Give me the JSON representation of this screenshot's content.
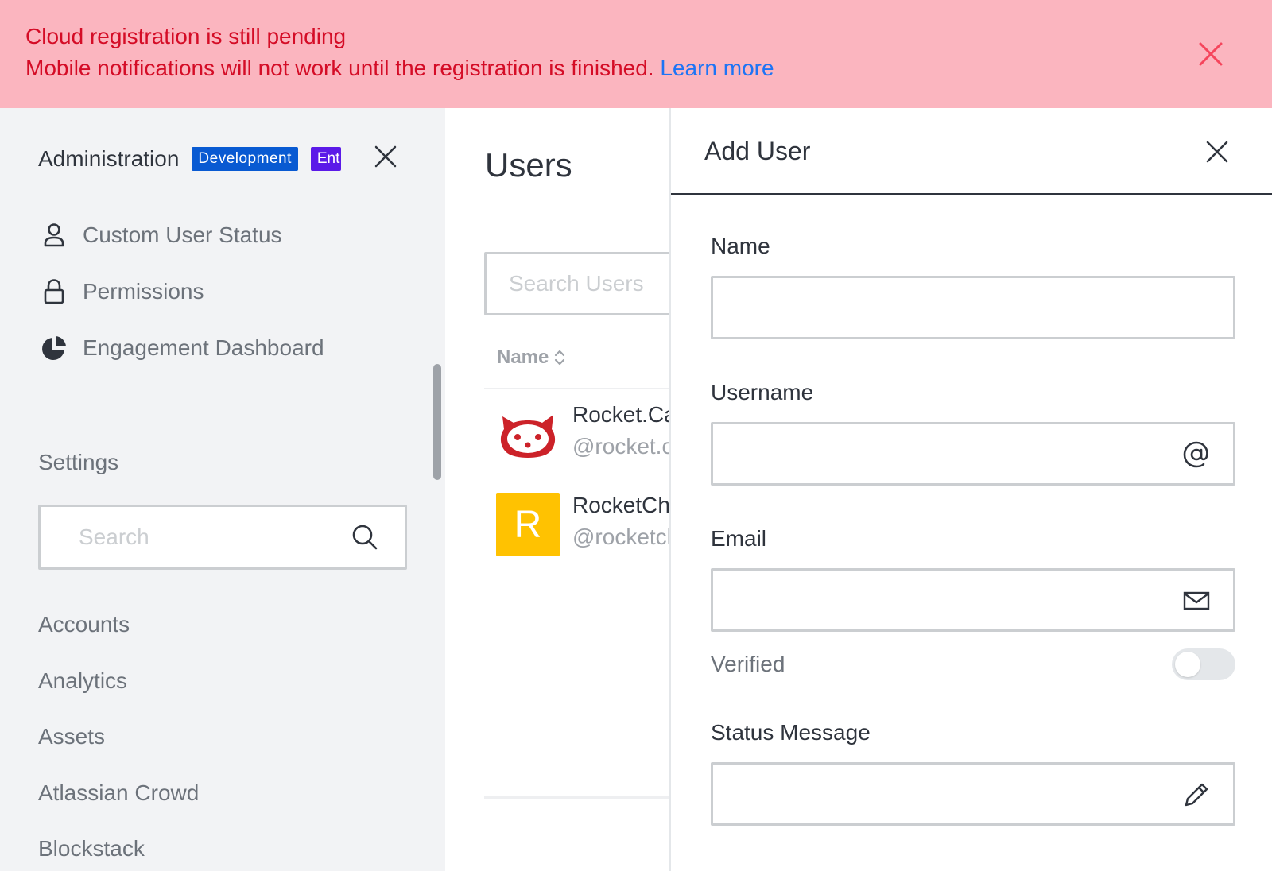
{
  "banner": {
    "title": "Cloud registration is still pending",
    "message": "Mobile notifications will not work until the registration is finished.",
    "link_label": "Learn more",
    "close_icon": "close-icon"
  },
  "sidebar": {
    "title": "Administration",
    "badges": [
      "Development",
      "Ent"
    ],
    "nav_items": [
      {
        "label": "Custom User Status",
        "icon": "user-icon"
      },
      {
        "label": "Permissions",
        "icon": "lock-icon"
      },
      {
        "label": "Engagement Dashboard",
        "icon": "pie-chart-icon"
      }
    ],
    "settings_heading": "Settings",
    "search_placeholder": "Search",
    "settings_items": [
      "Accounts",
      "Analytics",
      "Assets",
      "Atlassian Crowd",
      "Blockstack"
    ]
  },
  "users_page": {
    "title": "Users",
    "search_placeholder": "Search Users",
    "column_name": "Name",
    "rows": [
      {
        "name": "Rocket.Cat",
        "username": "@rocket.cat",
        "avatar": "rocket-cat-avatar"
      },
      {
        "name": "RocketChat",
        "username": "@rocketchat",
        "avatar_letter": "R"
      }
    ]
  },
  "add_user": {
    "title": "Add User",
    "fields": {
      "name_label": "Name",
      "username_label": "Username",
      "email_label": "Email",
      "verified_label": "Verified",
      "status_label": "Status Message"
    },
    "verified": false
  },
  "colors": {
    "banner_bg": "#fbb5bf",
    "banner_text": "#d40c26",
    "link": "#1d74f5",
    "badge_development": "#095ad2",
    "badge_enterprise": "#5b1ae8",
    "avatar_yellow": "#ffc201"
  }
}
